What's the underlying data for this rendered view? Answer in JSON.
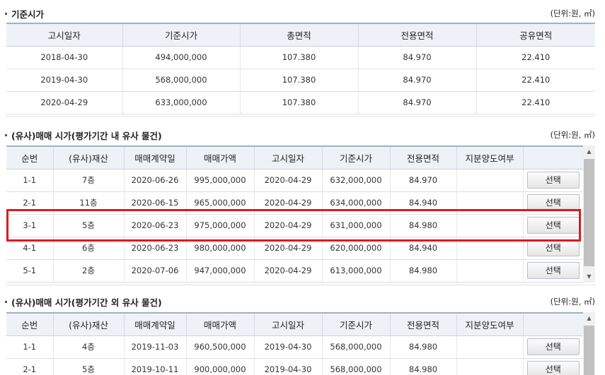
{
  "section1": {
    "title": "기준시가",
    "unit": "(단위:원, ㎡)",
    "headers": [
      "고시일자",
      "기준시가",
      "총면적",
      "전용면적",
      "공유면적"
    ],
    "rows": [
      [
        "2018-04-30",
        "494,000,000",
        "107.380",
        "84.970",
        "22.410"
      ],
      [
        "2019-04-30",
        "568,000,000",
        "107.380",
        "84.970",
        "22.410"
      ],
      [
        "2020-04-29",
        "633,000,000",
        "107.380",
        "84.970",
        "22.410"
      ]
    ]
  },
  "section2": {
    "title": "(유사)매매 시가(평가기간 내 유사 물건)",
    "unit": "(단위:원, ㎡)",
    "headers": [
      "순번",
      "(유사)재산",
      "매매계약일",
      "매매가액",
      "고시일자",
      "기준시가",
      "전용면적",
      "지분양도여부",
      ""
    ],
    "rows": [
      [
        "1-1",
        "7층",
        "2020-06-26",
        "995,000,000",
        "2020-04-29",
        "632,000,000",
        "84.970",
        "",
        "선택"
      ],
      [
        "2-1",
        "11층",
        "2020-06-15",
        "965,000,000",
        "2020-04-29",
        "634,000,000",
        "84.940",
        "",
        "선택"
      ],
      [
        "3-1",
        "5층",
        "2020-06-23",
        "975,000,000",
        "2020-04-29",
        "631,000,000",
        "84.980",
        "",
        "선택"
      ],
      [
        "4-1",
        "6층",
        "2020-06-23",
        "980,000,000",
        "2020-04-29",
        "620,000,000",
        "84.940",
        "",
        "선택"
      ],
      [
        "5-1",
        "2층",
        "2020-07-06",
        "947,000,000",
        "2020-04-29",
        "613,000,000",
        "84.980",
        "",
        "선택"
      ]
    ]
  },
  "section3": {
    "title": "(유사)매매 시가(평가기간 외 유사 물건)",
    "unit": "(단위:원, ㎡)",
    "headers": [
      "순번",
      "(유사)재산",
      "매매계약일",
      "매매가액",
      "고시일자",
      "기준시가",
      "전용면적",
      "지분양도여부",
      ""
    ],
    "rows": [
      [
        "1-1",
        "4층",
        "2019-11-03",
        "960,500,000",
        "2019-04-30",
        "568,000,000",
        "84.980",
        "",
        "선택"
      ],
      [
        "2-1",
        "5층",
        "2019-10-11",
        "900,000,000",
        "2019-04-30",
        "568,000,000",
        "84.980",
        "",
        "선택"
      ]
    ]
  },
  "icons": {
    "scroll_up": "▲",
    "scroll_down": "▼"
  },
  "colors": {
    "highlight": "#e0191f",
    "header_bg": "#eef1f6"
  }
}
